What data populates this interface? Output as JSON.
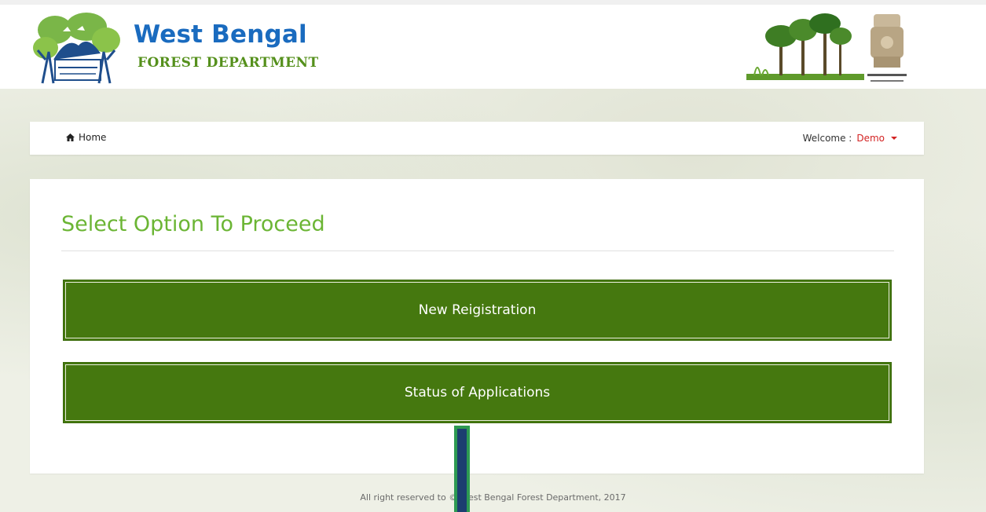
{
  "header": {
    "title": "West Bengal",
    "subtitle": "FOREST DEPARTMENT",
    "logo_icon": "forest-department-logo-icon",
    "trees_icon": "trees-illustration-icon",
    "emblem_icon": "government-emblem-icon",
    "brand_color": "#1a6bbf",
    "accent_color": "#55901c"
  },
  "nav": {
    "home_label": "Home",
    "home_icon": "home-icon",
    "welcome_label": "Welcome :",
    "user_name": "Demo",
    "user_color": "#d32323"
  },
  "main": {
    "title": "Select Option To Proceed",
    "title_color": "#6bb534",
    "options": [
      {
        "label": "New Reigistration"
      },
      {
        "label": "Status of Applications"
      }
    ],
    "button_color": "#45780f"
  },
  "footer": {
    "text": "All right reserved to © West Bengal Forest Department, 2017"
  }
}
